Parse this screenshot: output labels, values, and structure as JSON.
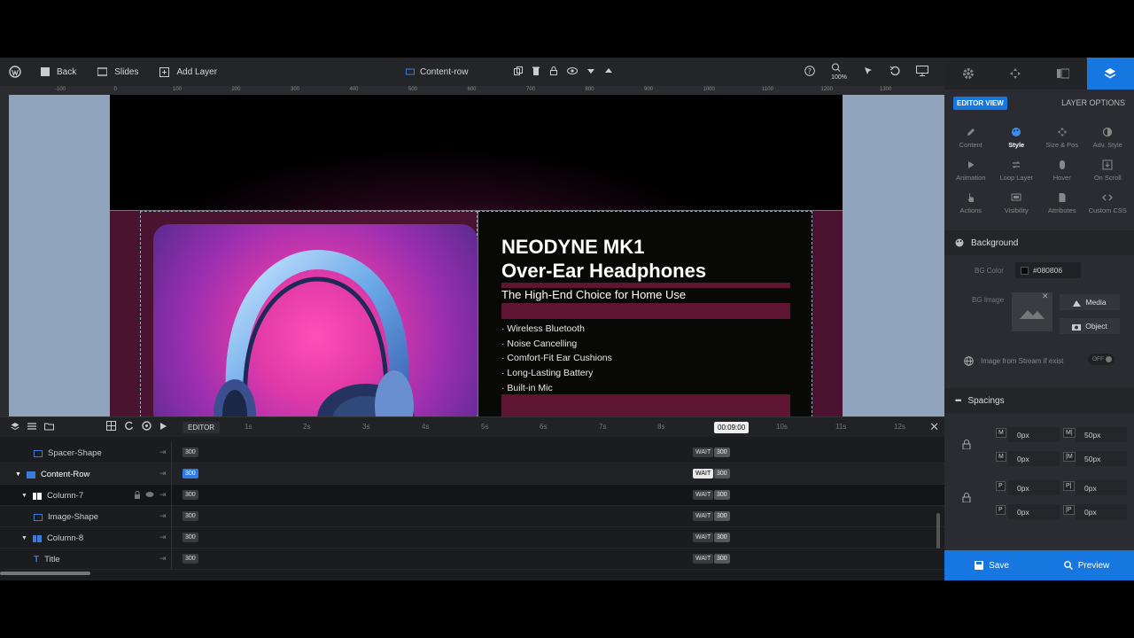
{
  "toolbar": {
    "back": "Back",
    "slides": "Slides",
    "add_layer": "Add Layer",
    "current_layer": "Content-row",
    "zoom": "100%"
  },
  "ruler": {
    "h_ticks": [
      "-100",
      "0",
      "100",
      "200",
      "300",
      "400",
      "500",
      "600",
      "700",
      "800",
      "900",
      "1000",
      "1100",
      "1200",
      "1300"
    ]
  },
  "slide": {
    "title_line1": "NEODYNE MK1",
    "title_line2": "Over-Ear Headphones",
    "subtitle": "The High-End Choice for Home Use",
    "features": [
      "Wireless Bluetooth",
      "Noise Cancelling",
      "Comfort-Fit Ear Cushions",
      "Long-Lasting Battery",
      "Built-in Mic"
    ]
  },
  "timeline": {
    "editor_label": "EDITOR",
    "ticks": [
      "1s",
      "2s",
      "3s",
      "4s",
      "5s",
      "6s",
      "7s",
      "8s",
      "10s",
      "11s",
      "12s"
    ],
    "current_time": "00:09:00",
    "rows": [
      {
        "name": "Spacer-Shape",
        "start": "300",
        "wait": "WAIT",
        "wait_val": "300"
      },
      {
        "name": "Content-Row",
        "start": "300",
        "wait": "WAIT",
        "wait_val": "300"
      },
      {
        "name": "Column-7",
        "start": "300",
        "wait": "WAIT",
        "wait_val": "300"
      },
      {
        "name": "Image-Shape",
        "start": "300",
        "wait": "WAIT",
        "wait_val": "300"
      },
      {
        "name": "Column-8",
        "start": "300",
        "wait": "WAIT",
        "wait_val": "300"
      },
      {
        "name": "Title",
        "start": "300",
        "wait": "WAIT",
        "wait_val": "300"
      }
    ]
  },
  "panel": {
    "editor_view": "EDITOR VIEW",
    "layer_options": "LAYER OPTIONS",
    "options": [
      {
        "label": "Content",
        "icon": "pencil-icon"
      },
      {
        "label": "Style",
        "icon": "palette-icon"
      },
      {
        "label": "Size & Pos",
        "icon": "move-icon"
      },
      {
        "label": "Adv. Style",
        "icon": "contrast-icon"
      },
      {
        "label": "Animation",
        "icon": "play-icon"
      },
      {
        "label": "Loop Layer",
        "icon": "loop-icon"
      },
      {
        "label": "Hover",
        "icon": "mouse-icon"
      },
      {
        "label": "On Scroll",
        "icon": "scroll-icon"
      },
      {
        "label": "Actions",
        "icon": "pointer-icon"
      },
      {
        "label": "Visibility",
        "icon": "visibility-icon"
      },
      {
        "label": "Attributes",
        "icon": "document-icon"
      },
      {
        "label": "Custom CSS",
        "icon": "code-icon"
      }
    ],
    "background": {
      "title": "Background",
      "bg_color_label": "BG Color",
      "bg_color_value": "#080806",
      "bg_image_label": "BG Image",
      "media": "Media",
      "object": "Object",
      "stream_label": "Image from Stream if exist",
      "stream_toggle": "OFF"
    },
    "spacings": {
      "title": "Spacings",
      "margin": [
        "0px",
        "50px",
        "0px",
        "50px"
      ],
      "margin_icons": [
        "M",
        "M|",
        "M",
        "|M"
      ],
      "padding": [
        "0px",
        "0px",
        "0px",
        "0px"
      ],
      "padding_icons": [
        "P",
        "P|",
        "P",
        "|P"
      ]
    },
    "save": "Save",
    "preview": "Preview"
  },
  "colors": {
    "accent": "#1677e0",
    "slide_row_bg": "#4a1430",
    "canvas_bg": "#8fa3bd"
  }
}
